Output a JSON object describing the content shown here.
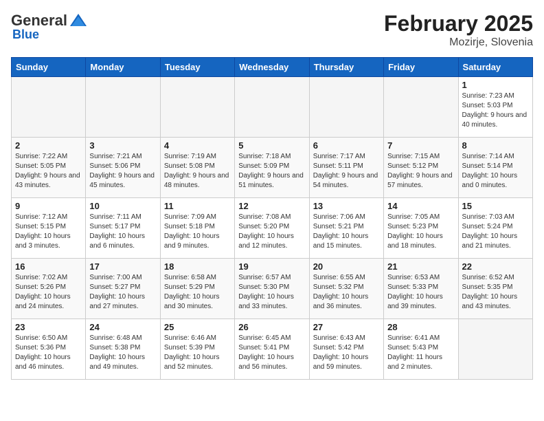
{
  "header": {
    "logo_general": "General",
    "logo_blue": "Blue",
    "month": "February 2025",
    "location": "Mozirje, Slovenia"
  },
  "days_of_week": [
    "Sunday",
    "Monday",
    "Tuesday",
    "Wednesday",
    "Thursday",
    "Friday",
    "Saturday"
  ],
  "weeks": [
    [
      {
        "day": "",
        "info": ""
      },
      {
        "day": "",
        "info": ""
      },
      {
        "day": "",
        "info": ""
      },
      {
        "day": "",
        "info": ""
      },
      {
        "day": "",
        "info": ""
      },
      {
        "day": "",
        "info": ""
      },
      {
        "day": "1",
        "info": "Sunrise: 7:23 AM\nSunset: 5:03 PM\nDaylight: 9 hours and 40 minutes."
      }
    ],
    [
      {
        "day": "2",
        "info": "Sunrise: 7:22 AM\nSunset: 5:05 PM\nDaylight: 9 hours and 43 minutes."
      },
      {
        "day": "3",
        "info": "Sunrise: 7:21 AM\nSunset: 5:06 PM\nDaylight: 9 hours and 45 minutes."
      },
      {
        "day": "4",
        "info": "Sunrise: 7:19 AM\nSunset: 5:08 PM\nDaylight: 9 hours and 48 minutes."
      },
      {
        "day": "5",
        "info": "Sunrise: 7:18 AM\nSunset: 5:09 PM\nDaylight: 9 hours and 51 minutes."
      },
      {
        "day": "6",
        "info": "Sunrise: 7:17 AM\nSunset: 5:11 PM\nDaylight: 9 hours and 54 minutes."
      },
      {
        "day": "7",
        "info": "Sunrise: 7:15 AM\nSunset: 5:12 PM\nDaylight: 9 hours and 57 minutes."
      },
      {
        "day": "8",
        "info": "Sunrise: 7:14 AM\nSunset: 5:14 PM\nDaylight: 10 hours and 0 minutes."
      }
    ],
    [
      {
        "day": "9",
        "info": "Sunrise: 7:12 AM\nSunset: 5:15 PM\nDaylight: 10 hours and 3 minutes."
      },
      {
        "day": "10",
        "info": "Sunrise: 7:11 AM\nSunset: 5:17 PM\nDaylight: 10 hours and 6 minutes."
      },
      {
        "day": "11",
        "info": "Sunrise: 7:09 AM\nSunset: 5:18 PM\nDaylight: 10 hours and 9 minutes."
      },
      {
        "day": "12",
        "info": "Sunrise: 7:08 AM\nSunset: 5:20 PM\nDaylight: 10 hours and 12 minutes."
      },
      {
        "day": "13",
        "info": "Sunrise: 7:06 AM\nSunset: 5:21 PM\nDaylight: 10 hours and 15 minutes."
      },
      {
        "day": "14",
        "info": "Sunrise: 7:05 AM\nSunset: 5:23 PM\nDaylight: 10 hours and 18 minutes."
      },
      {
        "day": "15",
        "info": "Sunrise: 7:03 AM\nSunset: 5:24 PM\nDaylight: 10 hours and 21 minutes."
      }
    ],
    [
      {
        "day": "16",
        "info": "Sunrise: 7:02 AM\nSunset: 5:26 PM\nDaylight: 10 hours and 24 minutes."
      },
      {
        "day": "17",
        "info": "Sunrise: 7:00 AM\nSunset: 5:27 PM\nDaylight: 10 hours and 27 minutes."
      },
      {
        "day": "18",
        "info": "Sunrise: 6:58 AM\nSunset: 5:29 PM\nDaylight: 10 hours and 30 minutes."
      },
      {
        "day": "19",
        "info": "Sunrise: 6:57 AM\nSunset: 5:30 PM\nDaylight: 10 hours and 33 minutes."
      },
      {
        "day": "20",
        "info": "Sunrise: 6:55 AM\nSunset: 5:32 PM\nDaylight: 10 hours and 36 minutes."
      },
      {
        "day": "21",
        "info": "Sunrise: 6:53 AM\nSunset: 5:33 PM\nDaylight: 10 hours and 39 minutes."
      },
      {
        "day": "22",
        "info": "Sunrise: 6:52 AM\nSunset: 5:35 PM\nDaylight: 10 hours and 43 minutes."
      }
    ],
    [
      {
        "day": "23",
        "info": "Sunrise: 6:50 AM\nSunset: 5:36 PM\nDaylight: 10 hours and 46 minutes."
      },
      {
        "day": "24",
        "info": "Sunrise: 6:48 AM\nSunset: 5:38 PM\nDaylight: 10 hours and 49 minutes."
      },
      {
        "day": "25",
        "info": "Sunrise: 6:46 AM\nSunset: 5:39 PM\nDaylight: 10 hours and 52 minutes."
      },
      {
        "day": "26",
        "info": "Sunrise: 6:45 AM\nSunset: 5:41 PM\nDaylight: 10 hours and 56 minutes."
      },
      {
        "day": "27",
        "info": "Sunrise: 6:43 AM\nSunset: 5:42 PM\nDaylight: 10 hours and 59 minutes."
      },
      {
        "day": "28",
        "info": "Sunrise: 6:41 AM\nSunset: 5:43 PM\nDaylight: 11 hours and 2 minutes."
      },
      {
        "day": "",
        "info": ""
      }
    ]
  ]
}
